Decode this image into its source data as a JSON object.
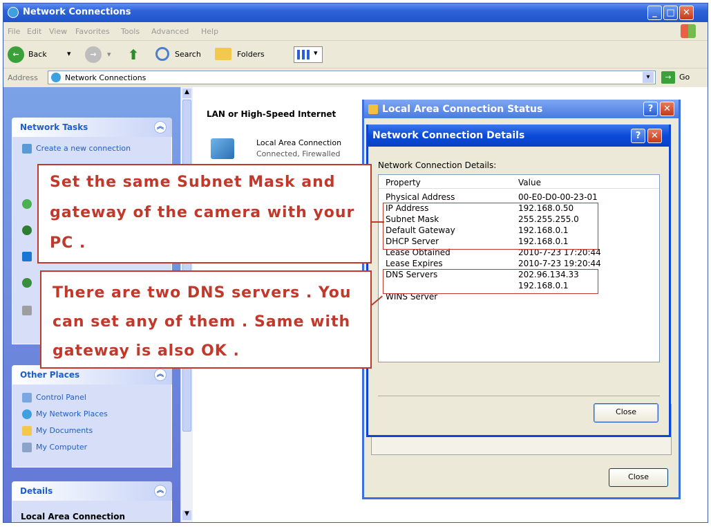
{
  "window": {
    "title": "Network Connections"
  },
  "menu": {
    "items": [
      "File",
      "Edit",
      "View",
      "Favorites",
      "Tools",
      "Advanced",
      "Help"
    ]
  },
  "toolbar": {
    "back": "Back",
    "search": "Search",
    "folders": "Folders"
  },
  "address": {
    "label": "Address",
    "value": "Network Connections",
    "go": "Go"
  },
  "sidebar": {
    "network_tasks": {
      "title": "Network Tasks",
      "items": [
        "Create a new connection"
      ]
    },
    "other_places": {
      "title": "Other Places",
      "items": [
        "Control Panel",
        "My Network Places",
        "My Documents",
        "My Computer"
      ]
    },
    "details": {
      "title": "Details",
      "name": "Local Area Connection"
    }
  },
  "content": {
    "group_header": "LAN or High-Speed Internet",
    "connection_name": "Local Area Connection",
    "connection_status": "Connected, Firewalled"
  },
  "status_dialog": {
    "title": "Local Area Connection Status",
    "close": "Close"
  },
  "details_dialog": {
    "title": "Network Connection Details",
    "label": "Network Connection Details:",
    "col_property": "Property",
    "col_value": "Value",
    "rows": [
      {
        "property": "Physical Address",
        "value": "00-E0-D0-00-23-01"
      },
      {
        "property": "IP Address",
        "value": "192.168.0.50"
      },
      {
        "property": "Subnet Mask",
        "value": "255.255.255.0"
      },
      {
        "property": "Default Gateway",
        "value": "192.168.0.1"
      },
      {
        "property": "DHCP Server",
        "value": "192.168.0.1"
      },
      {
        "property": "Lease Obtained",
        "value": "2010-7-23 17:20:44"
      },
      {
        "property": "Lease Expires",
        "value": "2010-7-23 19:20:44"
      },
      {
        "property": "DNS Servers",
        "value": "202.96.134.33"
      },
      {
        "property": "",
        "value": "192.168.0.1"
      },
      {
        "property": "WINS Server",
        "value": ""
      }
    ],
    "close": "Close"
  },
  "callouts": {
    "subnet": [
      "Set the same Subnet Mask and",
      "gateway of the camera with your",
      "PC ."
    ],
    "dns": [
      "There are two DNS servers . You",
      "can set any of them . Same with",
      "gateway is also OK ."
    ]
  },
  "colors": {
    "callout_red": "#c0392b",
    "xp_blue": "#0a46d6"
  }
}
